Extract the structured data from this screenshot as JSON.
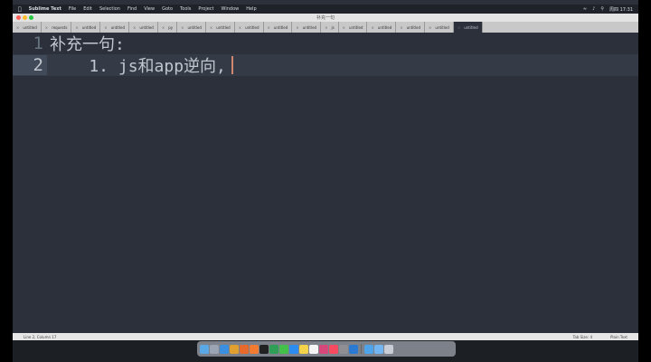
{
  "menubar": {
    "app_name": "Sublime Text",
    "items": [
      "File",
      "Edit",
      "Selection",
      "Find",
      "View",
      "Goto",
      "Tools",
      "Project",
      "Window",
      "Help"
    ],
    "status_clock": "周四 17:31"
  },
  "window": {
    "title": "补充一句"
  },
  "tabs": [
    "untitled",
    "requests",
    "untitled",
    "untitled",
    "untitled",
    "py",
    "untitled",
    "untitled",
    "untitled",
    "untitled",
    "untitled",
    "js",
    "untitled",
    "untitled",
    "untitled",
    "untitled",
    "untitled"
  ],
  "editor": {
    "lines": [
      {
        "number": "1",
        "text": "补充一句:"
      },
      {
        "number": "2",
        "text": "    1. js和app逆向,"
      }
    ]
  },
  "statusbar": {
    "position": "Line 2, Column 17",
    "tab_size": "Tab Size: 4",
    "syntax": "Plain Text"
  },
  "colors": {
    "background": "#2b303b",
    "gutter": "#65737e",
    "text": "#c0c5ce",
    "cursor": "#d08770"
  },
  "dock": {
    "icons": [
      "finder-icon",
      "launchpad-icon",
      "safari-icon",
      "chrome-icon",
      "firefox-icon",
      "sublime-icon",
      "terminal-icon",
      "pycharm-icon",
      "wechat-icon",
      "qq-icon",
      "notes-icon",
      "calendar-icon",
      "photos-icon",
      "music-icon",
      "settings-icon",
      "vscode-icon",
      "downloads-icon",
      "folder-icon",
      "trash-icon"
    ]
  }
}
